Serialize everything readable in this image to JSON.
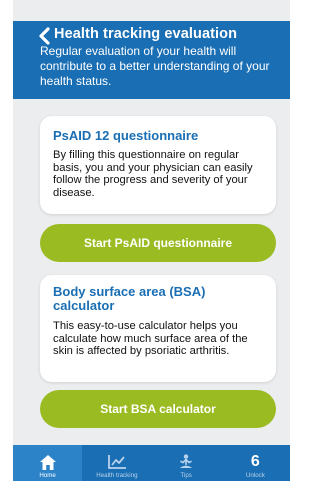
{
  "header": {
    "title": "Health tracking evaluation",
    "subtitle": "Regular evaluation of your health will contribute to a better understanding of your health status."
  },
  "cards": [
    {
      "title": "PsAID 12 questionnaire",
      "body": "By filling this questionnaire on regular basis, you and your physician can easily follow the progress and severity of your disease.",
      "button": "Start PsAID questionnaire"
    },
    {
      "title": "Body surface area (BSA) calculator",
      "body": "This easy-to-use calculator helps you calculate how much surface area of the skin is affected by psoriatic arthritis.",
      "button": "Start BSA calculator"
    }
  ],
  "tabs": [
    {
      "label": "Home",
      "icon": "home-icon"
    },
    {
      "label": "Health tracking",
      "icon": "chart-icon"
    },
    {
      "label": "Tips",
      "icon": "meditation-icon"
    },
    {
      "label": "Unlock",
      "icon": "number-icon",
      "glyph": "6"
    }
  ],
  "colors": {
    "primary": "#1a6eb4",
    "accent": "#9bbb22",
    "background": "#ecedef"
  }
}
